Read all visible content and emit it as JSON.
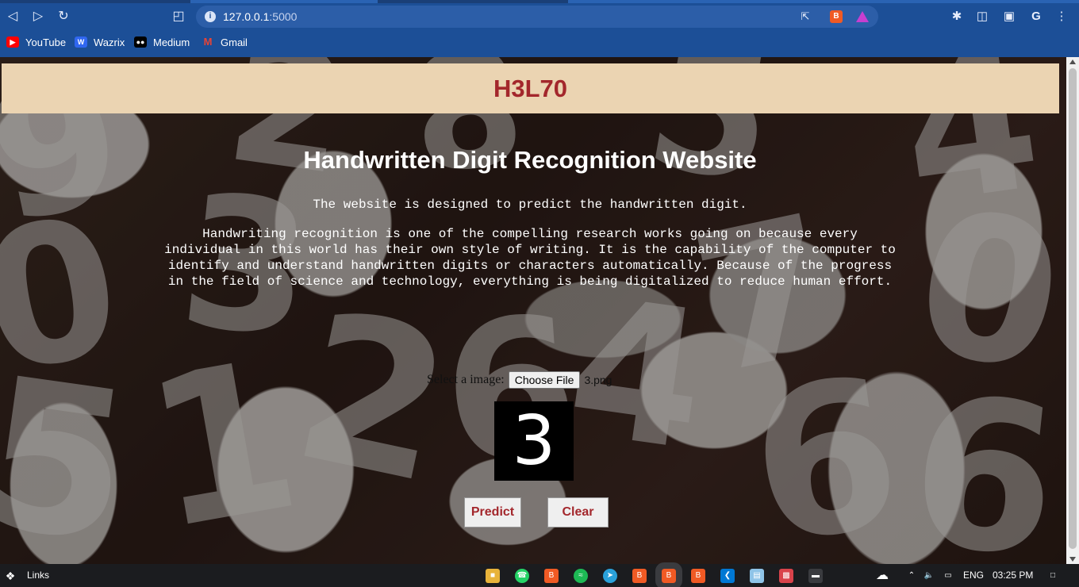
{
  "browser": {
    "url_host": "127.0.0.1",
    "url_port": ":5000",
    "bookmarks": [
      {
        "label": "YouTube",
        "icon": "youtube-icon",
        "color": "#ff0000"
      },
      {
        "label": "Wazrix",
        "icon": "wazirx-icon",
        "color": "#3067f0"
      },
      {
        "label": "Medium",
        "icon": "medium-icon",
        "color": "#000000"
      },
      {
        "label": "Gmail",
        "icon": "gmail-icon",
        "color": "#ea4335"
      }
    ]
  },
  "page": {
    "brand": "H3L70",
    "heading": "Handwritten Digit Recognition Website",
    "lead": "The website is designed to predict the handwritten digit.",
    "paragraph": "Handwriting recognition is one of the compelling research works going on because every individual in this world has their own style of writing. It is the capability of the computer to identify and understand handwritten digits or characters automatically. Because of the progress in the field of science and technology, everything is being digitalized to reduce human effort.",
    "upload_label": "Select a image:",
    "choose_file_label": "Choose File",
    "file_name": "3.png",
    "preview_digit": "3",
    "predict_label": "Predict",
    "clear_label": "Clear",
    "accent_color": "#a3272c",
    "banner_color": "#ebd4b2"
  },
  "taskbar": {
    "links_label": "Links",
    "language": "ENG",
    "time": "03:25 PM"
  }
}
